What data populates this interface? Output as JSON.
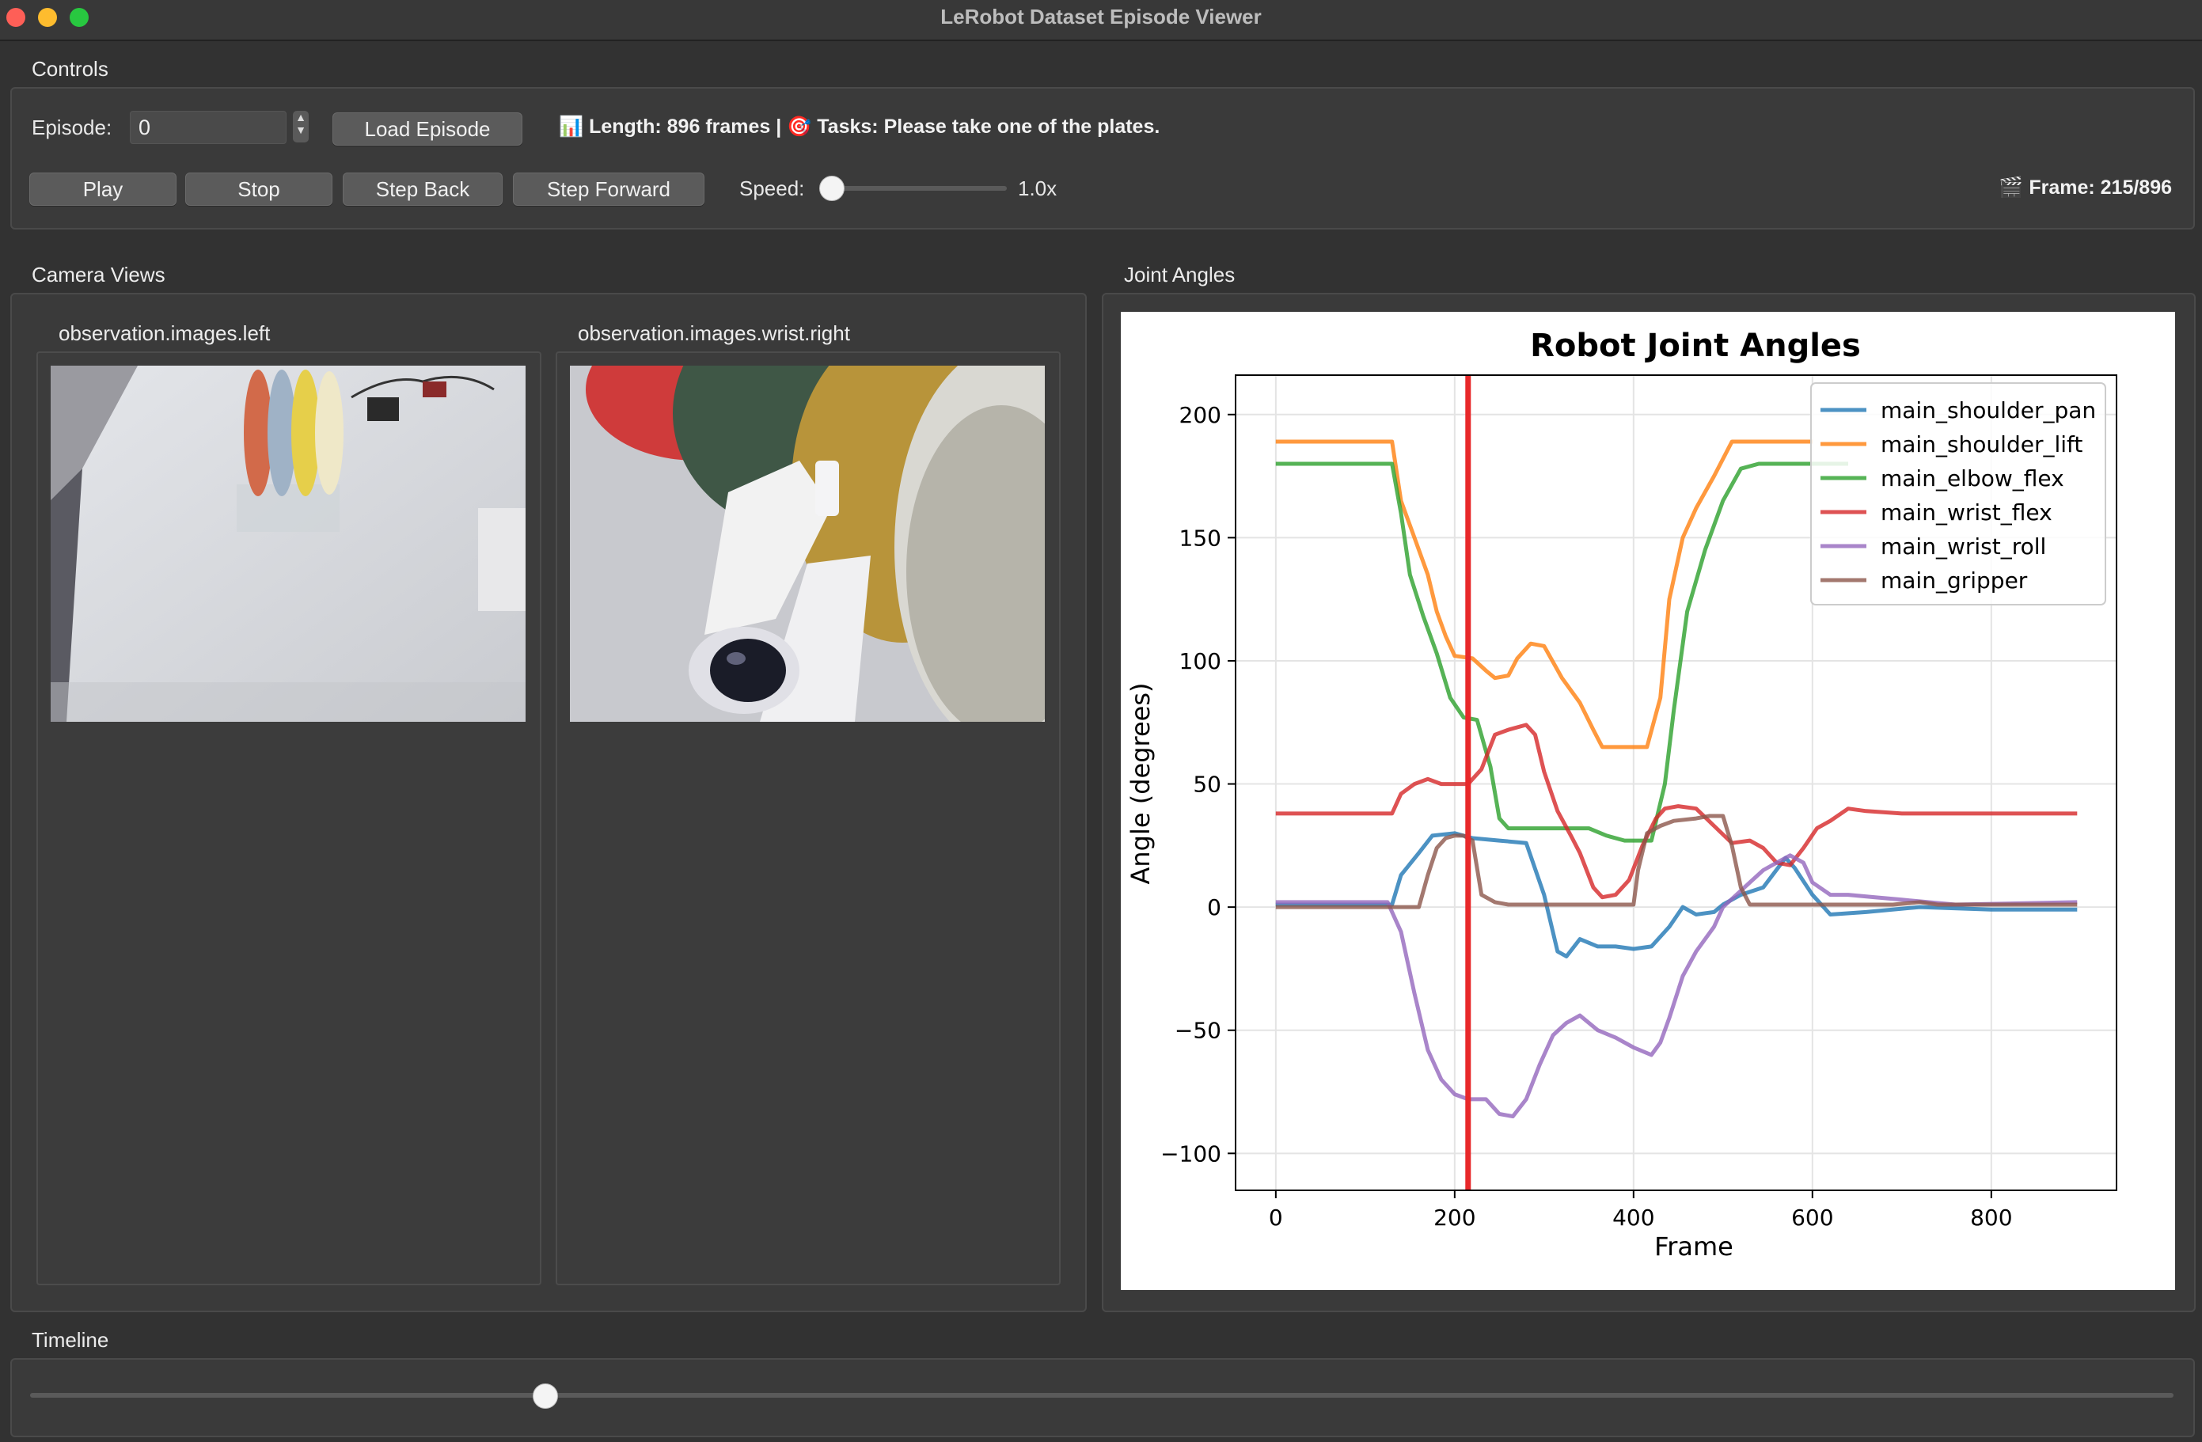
{
  "window": {
    "title": "LeRobot Dataset Episode Viewer"
  },
  "controls": {
    "section_title": "Controls",
    "episode_label": "Episode:",
    "episode_value": "0",
    "load_button": "Load Episode",
    "info_text": "📊 Length: 896 frames | 🎯 Tasks: Please take one of the plates.",
    "play": "Play",
    "stop": "Stop",
    "step_back": "Step Back",
    "step_forward": "Step Forward",
    "speed_label": "Speed:",
    "speed_value": "1.0x",
    "speed_fraction": 0.06,
    "frame_text": "🎬 Frame: 215/896"
  },
  "camera": {
    "section_title": "Camera Views",
    "left_label": "observation.images.left",
    "right_label": "observation.images.wrist.right"
  },
  "joints": {
    "section_title": "Joint Angles"
  },
  "timeline": {
    "section_title": "Timeline",
    "fraction": 0.24
  },
  "chart_data": {
    "type": "line",
    "title": "Robot Joint Angles",
    "xlabel": "Frame",
    "ylabel": "Angle (degrees)",
    "xlim": [
      -45,
      940
    ],
    "ylim": [
      -115,
      216
    ],
    "xticks": [
      0,
      200,
      400,
      600,
      800
    ],
    "yticks": [
      -100,
      -50,
      0,
      50,
      100,
      150,
      200
    ],
    "grid": true,
    "legend_position": "top-right",
    "current_frame": 215,
    "series": [
      {
        "name": "main_shoulder_pan",
        "color": "#1f77b4",
        "points": [
          [
            0,
            1
          ],
          [
            130,
            1
          ],
          [
            140,
            13
          ],
          [
            160,
            22
          ],
          [
            175,
            29
          ],
          [
            200,
            30
          ],
          [
            220,
            28
          ],
          [
            250,
            27
          ],
          [
            280,
            26
          ],
          [
            300,
            5
          ],
          [
            315,
            -18
          ],
          [
            325,
            -20
          ],
          [
            340,
            -13
          ],
          [
            360,
            -16
          ],
          [
            380,
            -16
          ],
          [
            400,
            -17
          ],
          [
            420,
            -16
          ],
          [
            440,
            -8
          ],
          [
            455,
            0
          ],
          [
            470,
            -3
          ],
          [
            490,
            -2
          ],
          [
            500,
            1
          ],
          [
            520,
            5
          ],
          [
            545,
            8
          ],
          [
            570,
            20
          ],
          [
            580,
            16
          ],
          [
            600,
            5
          ],
          [
            620,
            -3
          ],
          [
            660,
            -2
          ],
          [
            720,
            0
          ],
          [
            800,
            -1
          ],
          [
            896,
            -1
          ]
        ]
      },
      {
        "name": "main_shoulder_lift",
        "color": "#ff7f0e",
        "points": [
          [
            0,
            189
          ],
          [
            130,
            189
          ],
          [
            140,
            165
          ],
          [
            155,
            150
          ],
          [
            170,
            135
          ],
          [
            180,
            120
          ],
          [
            190,
            110
          ],
          [
            200,
            102
          ],
          [
            220,
            101
          ],
          [
            235,
            96
          ],
          [
            245,
            93
          ],
          [
            260,
            94
          ],
          [
            270,
            101
          ],
          [
            285,
            107
          ],
          [
            300,
            106
          ],
          [
            320,
            93
          ],
          [
            340,
            83
          ],
          [
            355,
            72
          ],
          [
            365,
            65
          ],
          [
            380,
            65
          ],
          [
            400,
            65
          ],
          [
            415,
            65
          ],
          [
            430,
            85
          ],
          [
            440,
            125
          ],
          [
            455,
            150
          ],
          [
            470,
            162
          ],
          [
            490,
            175
          ],
          [
            510,
            189
          ],
          [
            600,
            189
          ]
        ]
      },
      {
        "name": "main_elbow_flex",
        "color": "#2ca02c",
        "points": [
          [
            0,
            180
          ],
          [
            130,
            180
          ],
          [
            140,
            160
          ],
          [
            150,
            135
          ],
          [
            165,
            118
          ],
          [
            180,
            103
          ],
          [
            195,
            85
          ],
          [
            210,
            77
          ],
          [
            225,
            76
          ],
          [
            240,
            57
          ],
          [
            250,
            36
          ],
          [
            260,
            32
          ],
          [
            280,
            32
          ],
          [
            300,
            32
          ],
          [
            330,
            32
          ],
          [
            350,
            32
          ],
          [
            370,
            29
          ],
          [
            390,
            27
          ],
          [
            420,
            27
          ],
          [
            435,
            50
          ],
          [
            445,
            80
          ],
          [
            460,
            120
          ],
          [
            480,
            145
          ],
          [
            500,
            165
          ],
          [
            520,
            178
          ],
          [
            540,
            180
          ],
          [
            640,
            180
          ]
        ]
      },
      {
        "name": "main_wrist_flex",
        "color": "#d62728",
        "points": [
          [
            0,
            38
          ],
          [
            130,
            38
          ],
          [
            140,
            46
          ],
          [
            155,
            50
          ],
          [
            170,
            52
          ],
          [
            185,
            50
          ],
          [
            200,
            50
          ],
          [
            215,
            50
          ],
          [
            230,
            56
          ],
          [
            245,
            70
          ],
          [
            260,
            72
          ],
          [
            280,
            74
          ],
          [
            290,
            70
          ],
          [
            300,
            55
          ],
          [
            315,
            39
          ],
          [
            330,
            29
          ],
          [
            340,
            22
          ],
          [
            355,
            8
          ],
          [
            365,
            4
          ],
          [
            380,
            5
          ],
          [
            395,
            11
          ],
          [
            410,
            25
          ],
          [
            425,
            36
          ],
          [
            435,
            40
          ],
          [
            450,
            41
          ],
          [
            470,
            40
          ],
          [
            490,
            33
          ],
          [
            510,
            26
          ],
          [
            530,
            27
          ],
          [
            545,
            24
          ],
          [
            560,
            18
          ],
          [
            575,
            17
          ],
          [
            590,
            24
          ],
          [
            605,
            32
          ],
          [
            620,
            35
          ],
          [
            640,
            40
          ],
          [
            660,
            39
          ],
          [
            700,
            38
          ],
          [
            800,
            38
          ],
          [
            896,
            38
          ]
        ]
      },
      {
        "name": "main_wrist_roll",
        "color": "#9467bd",
        "points": [
          [
            0,
            2
          ],
          [
            125,
            2
          ],
          [
            140,
            -10
          ],
          [
            155,
            -35
          ],
          [
            170,
            -58
          ],
          [
            185,
            -70
          ],
          [
            200,
            -76
          ],
          [
            215,
            -78
          ],
          [
            235,
            -78
          ],
          [
            250,
            -84
          ],
          [
            265,
            -85
          ],
          [
            280,
            -78
          ],
          [
            295,
            -64
          ],
          [
            310,
            -52
          ],
          [
            325,
            -47
          ],
          [
            340,
            -44
          ],
          [
            360,
            -50
          ],
          [
            380,
            -53
          ],
          [
            400,
            -57
          ],
          [
            420,
            -60
          ],
          [
            430,
            -55
          ],
          [
            440,
            -45
          ],
          [
            455,
            -28
          ],
          [
            470,
            -18
          ],
          [
            490,
            -8
          ],
          [
            500,
            0
          ],
          [
            515,
            5
          ],
          [
            530,
            10
          ],
          [
            545,
            15
          ],
          [
            560,
            18
          ],
          [
            575,
            21
          ],
          [
            590,
            18
          ],
          [
            600,
            10
          ],
          [
            620,
            5
          ],
          [
            640,
            5
          ],
          [
            670,
            4
          ],
          [
            700,
            3
          ],
          [
            760,
            1
          ],
          [
            896,
            2
          ]
        ]
      },
      {
        "name": "main_gripper",
        "color": "#8c564b",
        "points": [
          [
            0,
            0
          ],
          [
            160,
            0
          ],
          [
            170,
            13
          ],
          [
            180,
            24
          ],
          [
            190,
            28
          ],
          [
            200,
            29
          ],
          [
            210,
            29
          ],
          [
            220,
            27
          ],
          [
            230,
            5
          ],
          [
            245,
            2
          ],
          [
            260,
            1
          ],
          [
            300,
            1
          ],
          [
            380,
            1
          ],
          [
            400,
            1
          ],
          [
            405,
            15
          ],
          [
            415,
            30
          ],
          [
            430,
            33
          ],
          [
            445,
            35
          ],
          [
            470,
            36
          ],
          [
            485,
            37
          ],
          [
            500,
            37
          ],
          [
            510,
            25
          ],
          [
            520,
            8
          ],
          [
            530,
            1
          ],
          [
            560,
            1
          ],
          [
            620,
            1
          ],
          [
            690,
            1
          ],
          [
            720,
            2
          ],
          [
            740,
            1
          ],
          [
            896,
            1
          ]
        ]
      }
    ]
  }
}
